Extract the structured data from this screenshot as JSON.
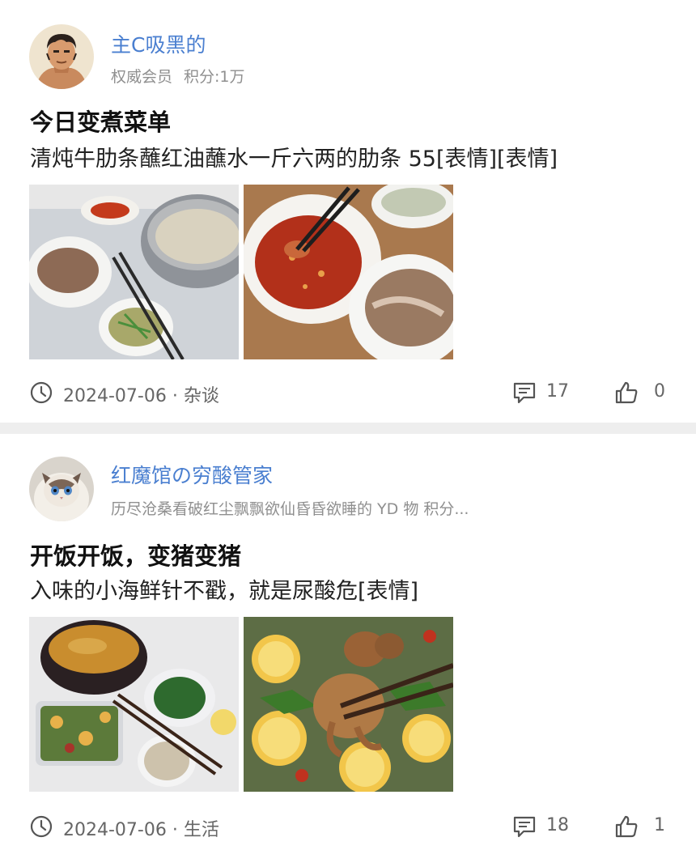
{
  "posts": [
    {
      "author": {
        "name": "主C吸黑的",
        "badge": "权威会员",
        "points": "积分:1万",
        "avatar_icon": "muscular-man-avatar"
      },
      "title": "今日变煮菜单",
      "body": "清炖牛肋条蘸红油蘸水一斤六两的肋条 55[表情][表情]",
      "photos": [
        "beef-stew-pot-photo",
        "chili-dip-beef-photo"
      ],
      "date": "2024-07-06",
      "category": "杂谈",
      "comments": "17",
      "likes": "0"
    },
    {
      "author": {
        "name": "红魔馆の穷酸管家",
        "meta": "历尽沧桑看破红尘飘飘欲仙昏昏欲睡的 YD 物  积分...",
        "avatar_icon": "ragdoll-cat-avatar"
      },
      "title": "开饭开饭，变猪变猪",
      "body": "入味的小海鲜针不戳，就是尿酸危[表情]",
      "photos": [
        "family-dinner-table-photo",
        "lemon-octopus-seafood-photo"
      ],
      "date": "2024-07-06",
      "category": "生活",
      "comments": "18",
      "likes": "1"
    }
  ],
  "colors": {
    "author_name": "#4a7fd0",
    "meta_text": "#8f8f8f",
    "separator": "#eeeeee"
  }
}
